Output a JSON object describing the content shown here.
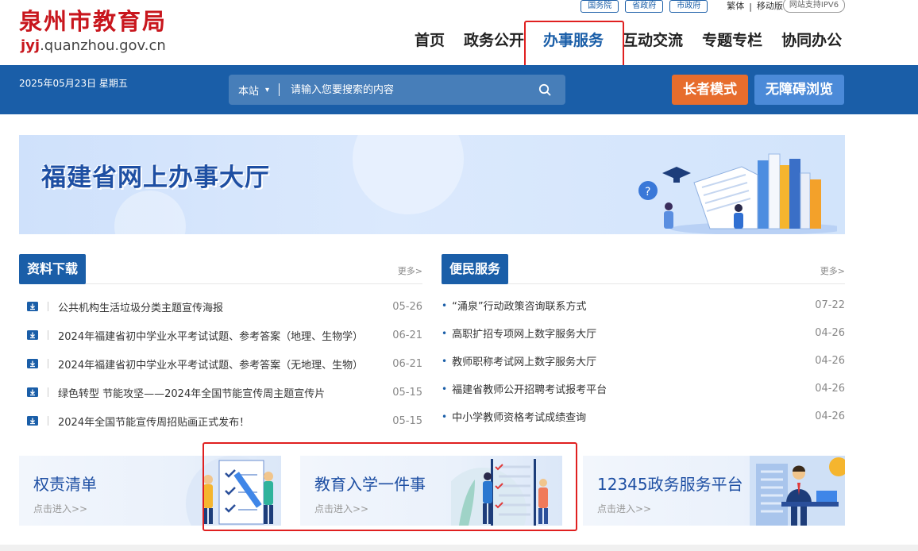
{
  "header": {
    "logo_cn": "泉州市教育局",
    "logo_en_accent": "jyj",
    "logo_en_rest": ".quanzhou.gov.cn",
    "gov_links": [
      "国务院",
      "省政府",
      "市政府"
    ],
    "traditional": "繁体",
    "separator": "|",
    "mobile": "移动版",
    "ipv6": "网站支持IPV6"
  },
  "nav": {
    "items": [
      "首页",
      "政务公开",
      "办事服务",
      "互动交流",
      "专题专栏",
      "协同办公"
    ],
    "active": "办事服务"
  },
  "bar": {
    "date": "2025年05月23日   星期五",
    "search_scope": "本站",
    "search_placeholder": "请输入您要搜索的内容",
    "elder_mode": "长者模式",
    "accessible": "无障碍浏览"
  },
  "banner": {
    "title": "福建省网上办事大厅"
  },
  "downloads": {
    "title": "资料下载",
    "more": "更多>",
    "items": [
      {
        "text": "公共机构生活垃圾分类主题宣传海报",
        "date": "05-26"
      },
      {
        "text": "2024年福建省初中学业水平考试试题、参考答案（地理、生物学）",
        "date": "06-21"
      },
      {
        "text": "2024年福建省初中学业水平考试试题、参考答案（无地理、生物）",
        "date": "06-21"
      },
      {
        "text": "绿色转型 节能攻坚——2024年全国节能宣传周主题宣传片",
        "date": "05-15"
      },
      {
        "text": "2024年全国节能宣传周招贴画正式发布！",
        "date": "05-15"
      }
    ]
  },
  "services": {
    "title": "便民服务",
    "more": "更多>",
    "items": [
      {
        "text": "“涌泉”行动政策咨询联系方式",
        "date": "07-22"
      },
      {
        "text": "高职扩招专项网上数字服务大厅",
        "date": "04-26"
      },
      {
        "text": "教师职称考试网上数字服务大厅",
        "date": "04-26"
      },
      {
        "text": "福建省教师公开招聘考试报考平台",
        "date": "04-26"
      },
      {
        "text": "中小学教师资格考试成绩查询",
        "date": "04-26"
      }
    ]
  },
  "cards": [
    {
      "title": "权责清单",
      "sub": "点击进入>>"
    },
    {
      "title": "教育入学一件事",
      "sub": "点击进入>>"
    },
    {
      "title": "12345政务服务平台",
      "sub": "点击进入>>"
    }
  ],
  "colors": {
    "brand_red": "#c8161d",
    "primary_blue": "#1a5ea8",
    "elder_orange": "#e76d2d",
    "access_blue": "#4b8ad8",
    "highlight_red": "#e02020"
  }
}
